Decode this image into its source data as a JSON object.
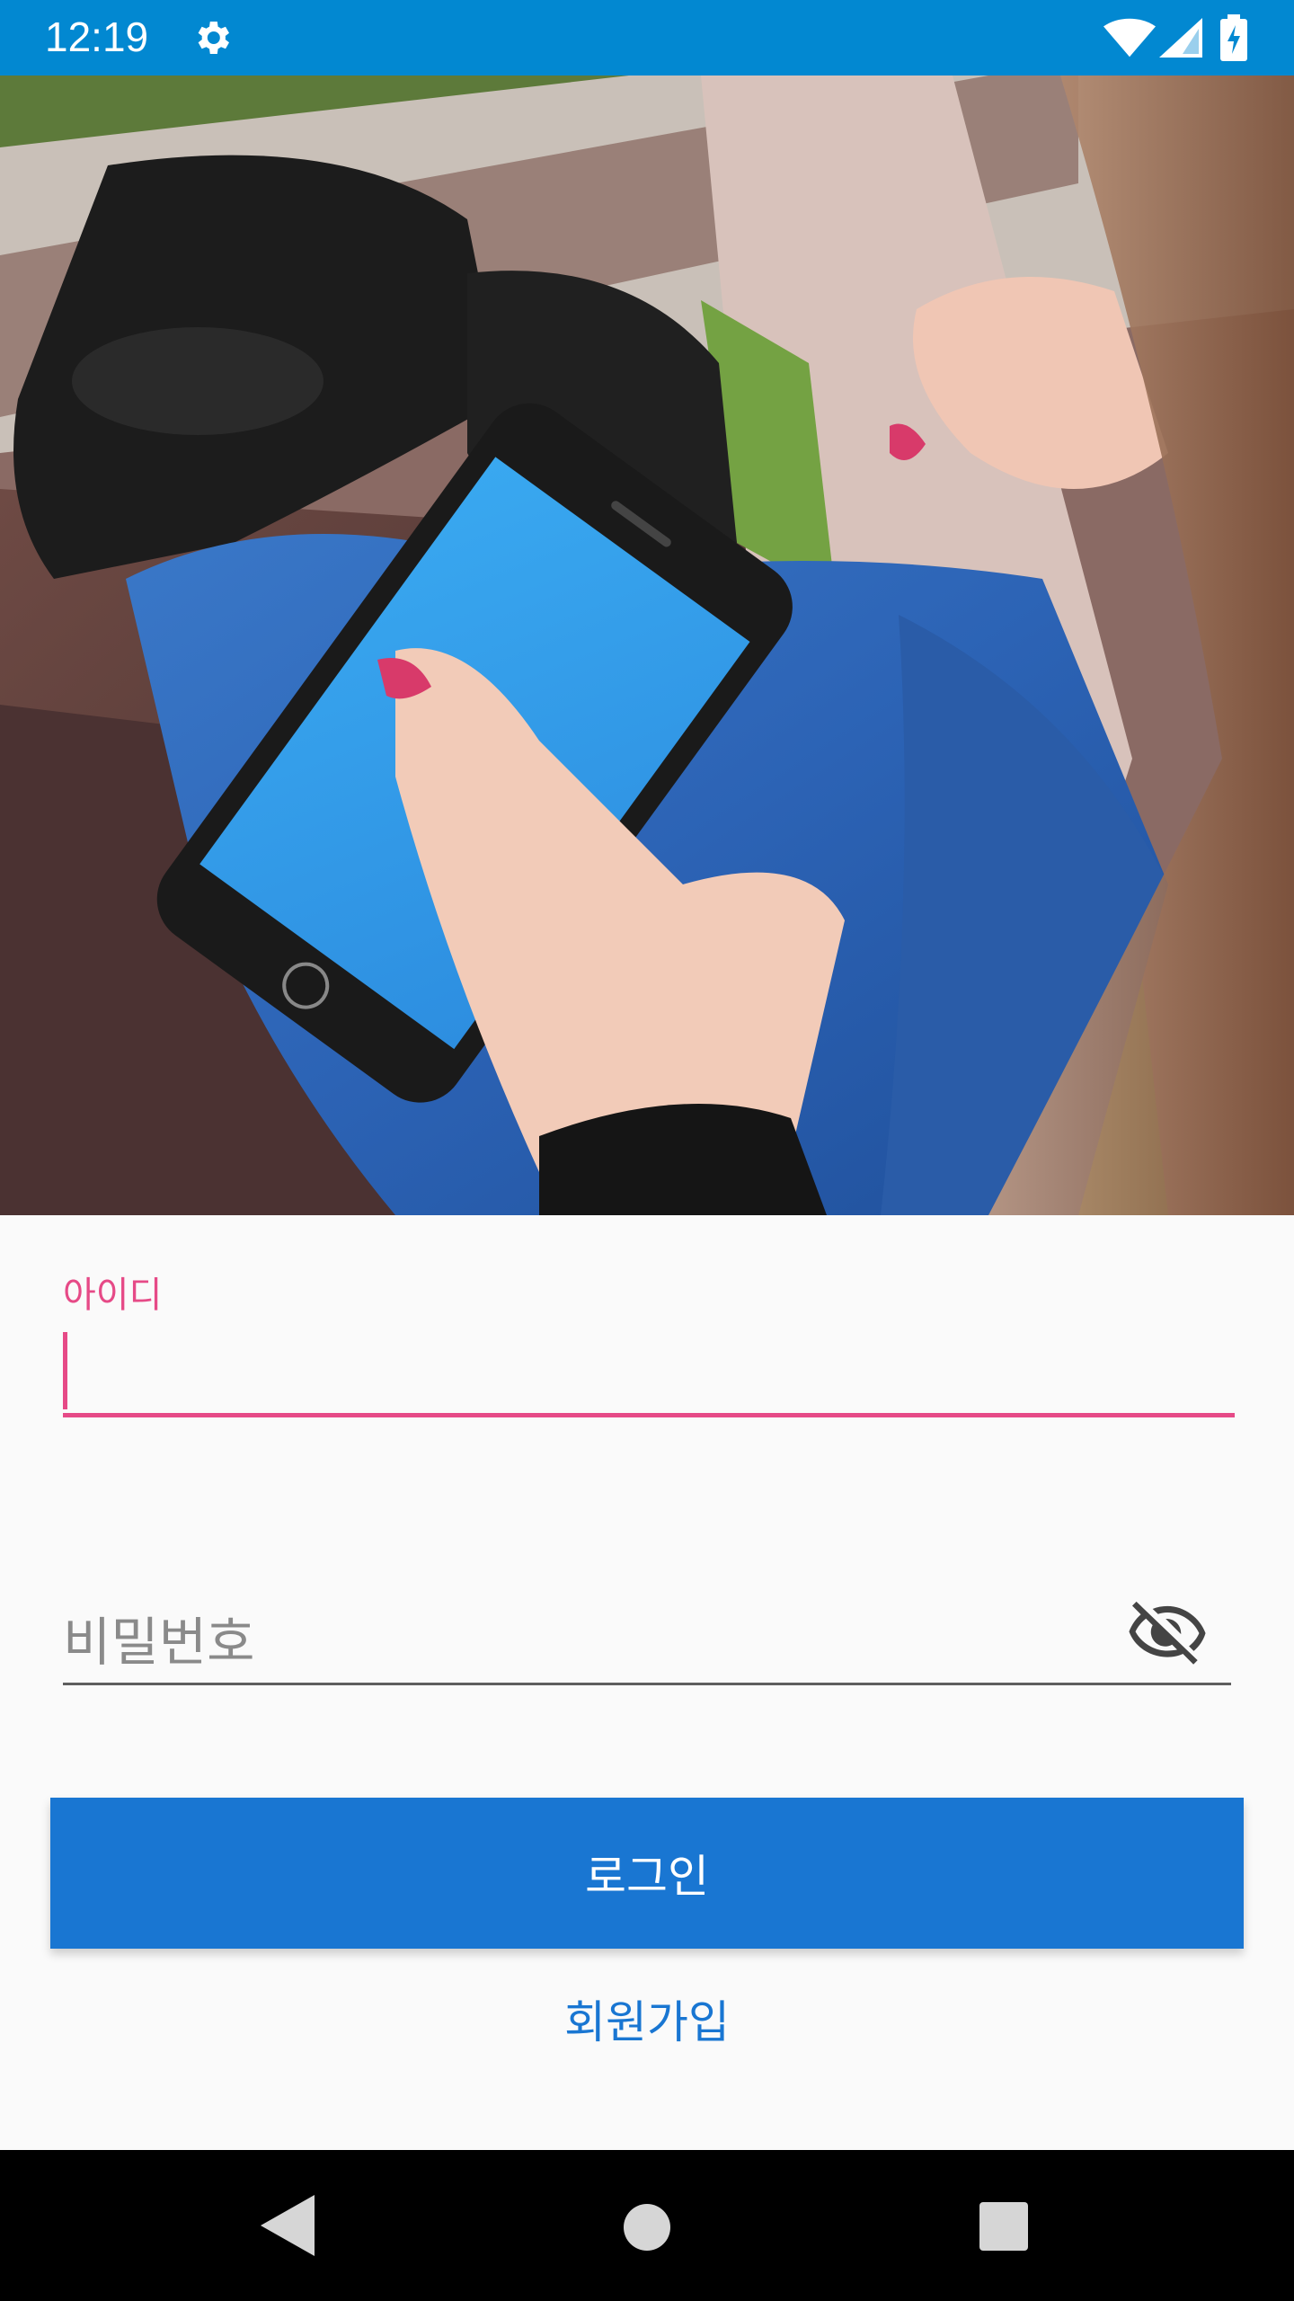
{
  "status_bar": {
    "time": "12:19",
    "icons": [
      "gear-icon",
      "wifi-icon",
      "cellular-signal-icon",
      "battery-charging-icon"
    ],
    "color": "#0288d1"
  },
  "hero_image": {
    "subject": "phone-in-hands-photo"
  },
  "login_form": {
    "id_label": "아이디",
    "id_value": "",
    "password_placeholder": "비밀번호",
    "password_toggle_icon": "visibility-off-icon",
    "login_button_label": "로그인",
    "signup_link_label": "회원가입",
    "accent_color": "#e64a87",
    "button_color": "#1976d2"
  },
  "navigation_bar": {
    "icons": [
      "back-icon",
      "home-icon",
      "recents-icon"
    ]
  }
}
